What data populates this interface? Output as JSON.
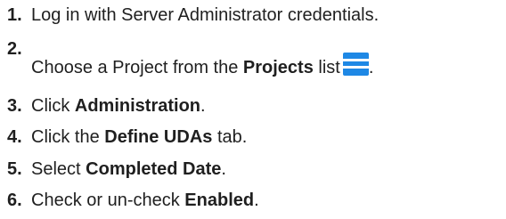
{
  "steps": [
    {
      "num": "1.",
      "parts": [
        "Log in with Server Administrator credentials."
      ]
    },
    {
      "num": "2.",
      "parts": [
        "Choose a Project from the ",
        "Projects",
        " list",
        "."
      ],
      "icon": "hamburger-list-icon",
      "icon_color": "#1e88e5"
    },
    {
      "num": "3.",
      "parts": [
        "Click ",
        "Administration",
        "."
      ]
    },
    {
      "num": "4.",
      "parts": [
        "Click the ",
        "Define UDAs",
        " tab."
      ]
    },
    {
      "num": "5.",
      "parts": [
        "Select ",
        "Completed Date",
        "."
      ]
    },
    {
      "num": "6.",
      "parts": [
        "Check or un-check ",
        "Enabled",
        "."
      ]
    }
  ]
}
